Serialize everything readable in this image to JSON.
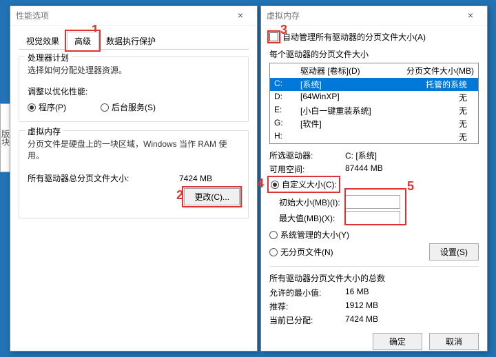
{
  "left_stub": "版块",
  "perf": {
    "title": "性能选项",
    "tabs": {
      "visual": "视觉效果",
      "advanced": "高级",
      "dep": "数据执行保护"
    },
    "cpu": {
      "title": "处理器计划",
      "desc": "选择如何分配处理器资源。",
      "adjust_label": "调整以优化性能:",
      "programs": "程序(P)",
      "services": "后台服务(S)"
    },
    "vm": {
      "title": "虚拟内存",
      "desc": "分页文件是硬盘上的一块区域，Windows 当作 RAM 使用。",
      "total_label": "所有驱动器总分页文件大小:",
      "total_value": "7424 MB",
      "change": "更改(C)..."
    }
  },
  "vmdlg": {
    "title": "虚拟内存",
    "auto": "自动管理所有驱动器的分页文件大小(A)",
    "each_label": "每个驱动器的分页文件大小",
    "cols": {
      "drive": "驱动器 [卷标](D)",
      "size": "分页文件大小(MB)"
    },
    "drives": [
      {
        "letter": "C:",
        "label": "[系统]",
        "size": "托管的系统",
        "sel": true
      },
      {
        "letter": "D:",
        "label": "[64WinXP]",
        "size": "无"
      },
      {
        "letter": "E:",
        "label": "[小白一键重装系统]",
        "size": "无"
      },
      {
        "letter": "G:",
        "label": "[软件]",
        "size": "无"
      },
      {
        "letter": "H:",
        "label": "",
        "size": "无"
      }
    ],
    "selected_drive_label": "所选驱动器:",
    "selected_drive_value": "C:  [系统]",
    "available_label": "可用空间:",
    "available_value": "87444 MB",
    "custom": "自定义大小(C):",
    "initial": "初始大小(MB)(I):",
    "max": "最大值(MB)(X):",
    "system_managed": "系统管理的大小(Y)",
    "no_paging": "无分页文件(N)",
    "set": "设置(S)",
    "totals_title": "所有驱动器分页文件大小的总数",
    "min_label": "允许的最小值:",
    "min_value": "16 MB",
    "rec_label": "推荐:",
    "rec_value": "1912 MB",
    "cur_label": "当前已分配:",
    "cur_value": "7424 MB",
    "ok": "确定",
    "cancel": "取消"
  },
  "anno": {
    "n1": "1",
    "n2": "2",
    "n3": "3",
    "n4": "4",
    "n5": "5"
  }
}
